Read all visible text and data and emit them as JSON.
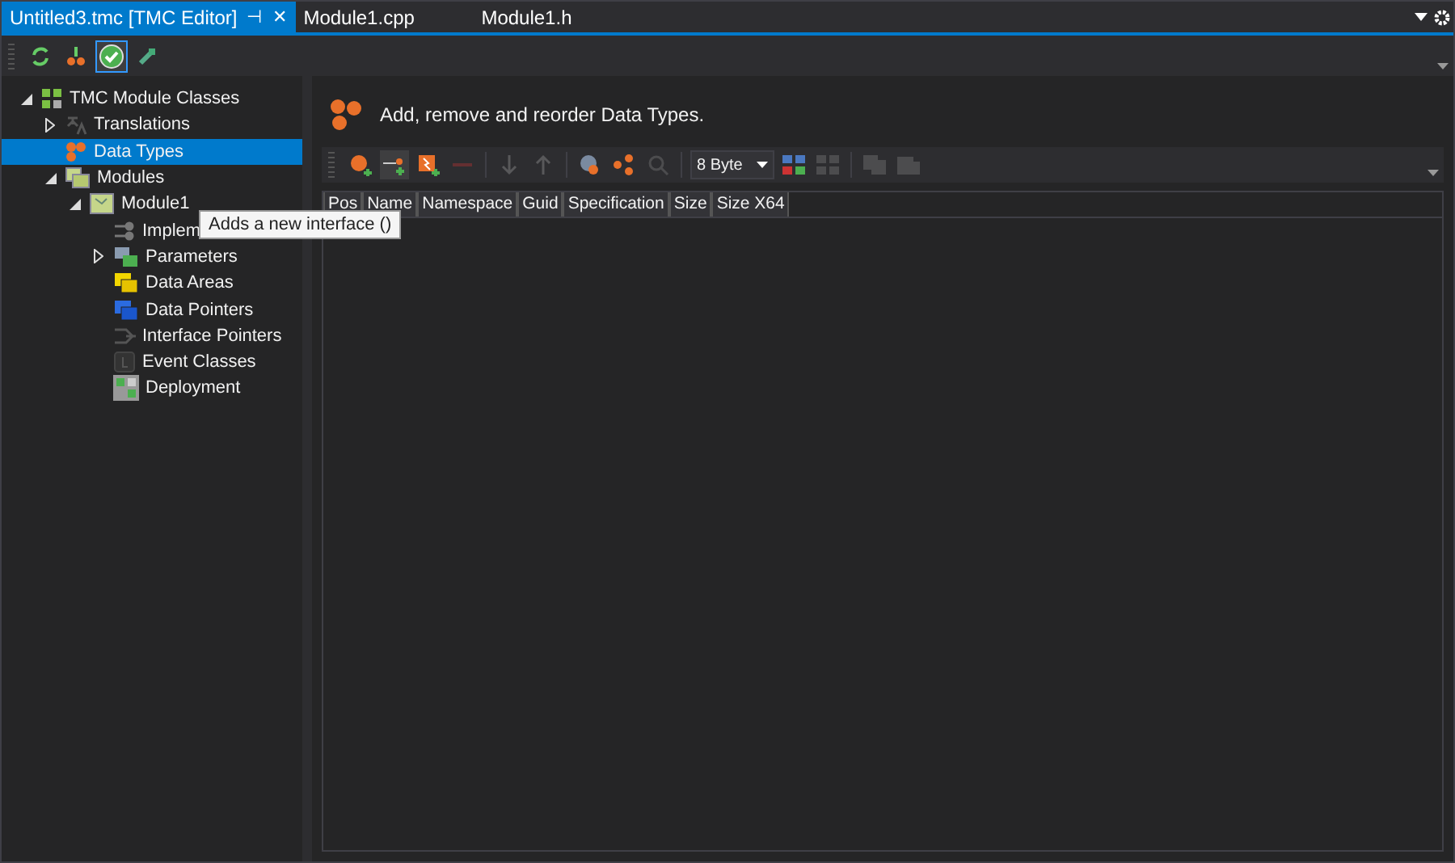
{
  "tabs": [
    {
      "label": "Untitled3.tmc [TMC Editor]",
      "selected": true,
      "pin": "⊣",
      "close": "✕"
    },
    {
      "label": "Module1.cpp",
      "selected": false
    },
    {
      "label": "Module1.h",
      "selected": false
    }
  ],
  "toolbar": [
    {
      "pressed": false
    },
    {
      "pressed": false
    },
    {
      "pressed": true
    },
    {
      "pressed": false
    }
  ],
  "tree": [
    {
      "label": "TMC Module Classes",
      "selected": false,
      "expanded": true,
      "children": [
        {
          "label": "Translations",
          "selected": false,
          "expanded": false
        },
        {
          "label": "Data Types",
          "selected": true
        },
        {
          "label": "Modules",
          "selected": false,
          "expanded": true,
          "children": [
            {
              "label": "Module1",
              "selected": false,
              "expanded": true,
              "children": [
                {
                  "label": "Implem",
                  "selected": false
                },
                {
                  "label": "Parameters",
                  "selected": false,
                  "expanded": false
                },
                {
                  "label": "Data Areas",
                  "selected": false
                },
                {
                  "label": "Data Pointers",
                  "selected": false
                },
                {
                  "label": "Interface Pointers",
                  "selected": false
                },
                {
                  "label": "Event Classes",
                  "selected": false
                },
                {
                  "label": "Deployment",
                  "selected": false
                }
              ]
            }
          ]
        }
      ]
    }
  ],
  "heading": "Add, remove and reorder Data Types.",
  "grid_toolbar": {
    "buttons": [
      {
        "disabled": false,
        "hovered": false
      },
      {
        "disabled": false,
        "hovered": true
      },
      {
        "disabled": false,
        "hovered": false
      },
      {
        "disabled": true,
        "hovered": false
      },
      {
        "disabled": true,
        "hovered": false
      },
      {
        "disabled": true,
        "hovered": false
      },
      {
        "disabled": false,
        "hovered": false
      },
      {
        "disabled": false,
        "hovered": false
      },
      {
        "disabled": true,
        "hovered": false
      }
    ],
    "dropdown": "8 Byte",
    "buttons_after": [
      {
        "disabled": false
      },
      {
        "disabled": true
      },
      {
        "disabled": true
      },
      {
        "disabled": true
      }
    ]
  },
  "columns": [
    "Pos",
    "Name",
    "Namespace",
    "Guid",
    "Specification",
    "Size",
    "Size X64"
  ],
  "tooltip": "Adds a new interface ()"
}
